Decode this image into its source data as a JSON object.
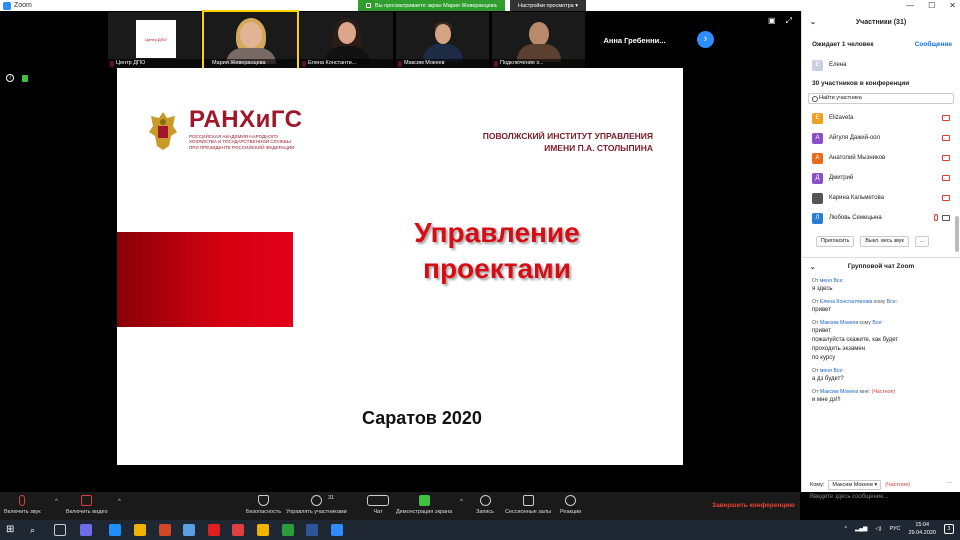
{
  "window": {
    "title": "Zoom",
    "controls": [
      "—",
      "☐",
      "✕"
    ]
  },
  "share_banner": {
    "text": "Вы просматриваете экран Мария Жеверанцева",
    "view_options": "Настройки просмотра ▾"
  },
  "video_tiles": [
    {
      "name": "Центр ДПО",
      "logo_text": "Центр ДПО"
    },
    {
      "name": "Мария Жеверанцева"
    },
    {
      "name": "Елена Константи..."
    },
    {
      "name": "Максим Мокеев"
    },
    {
      "name": "Подключение з..."
    },
    {
      "name": "Анна  Гребенни..."
    }
  ],
  "slide": {
    "brand": "РАНХиГС",
    "brand_sub": "Российская академия народного хозяйства и государственной службы при президенте российской федерации",
    "institute_line1": "ПОВОЛЖСКИЙ ИНСТИТУТ УПРАВЛЕНИЯ",
    "institute_line2": "ИМЕНИ П.А. СТОЛЫПИНА",
    "title_line1": "Управление",
    "title_line2": "проектами",
    "city": "Саратов 2020"
  },
  "participants_panel": {
    "title": "Участники (31)",
    "waiting_label": "Ожидает 1 человек",
    "message_link": "Сообщение",
    "waiting_user": {
      "initial": "Е",
      "name": "Елена",
      "color": "#c9d0e0"
    },
    "in_conference": "30 участников в конференции",
    "search_placeholder": "Найти участника",
    "participants": [
      {
        "initial": "E",
        "name": "Elizaveta",
        "color": "#f0a020"
      },
      {
        "initial": "А",
        "name": "Айгуля Дажий-оол",
        "color": "#8a4fc8"
      },
      {
        "initial": "А",
        "name": "Анатолий Мызников",
        "color": "#e86a1a"
      },
      {
        "initial": "Д",
        "name": "Дмитрий",
        "color": "#8a4fc8"
      },
      {
        "initial": "",
        "name": "Карина Кальметова",
        "color": "#555555"
      },
      {
        "initial": "Л",
        "name": "Любовь Семецына",
        "color": "#2a7ad8"
      }
    ],
    "invite_button": "Пригласить",
    "mute_all_button": "Выкл. весь звук",
    "more_button": "..."
  },
  "chat": {
    "title": "Групповой чат Zoom",
    "messages": [
      {
        "prefix": "От ",
        "from": "меня",
        "mid": " ",
        "to": "Все",
        "suffix": ":",
        "text": "я здесь"
      },
      {
        "prefix": "От ",
        "from": "Елена Константинова",
        "mid": " кому ",
        "to": "Все",
        "suffix": ":",
        "text": "привет"
      },
      {
        "prefix": "От ",
        "from": "Максим Мокеев",
        "mid": " кому ",
        "to": "Все",
        "suffix": ":",
        "text": "привет\nпожалуйста скажите, как будет\nпроходить экзамен\nпо курсу"
      },
      {
        "prefix": "От ",
        "from": "меня",
        "mid": " ",
        "to": "Все",
        "suffix": ":",
        "text": "а дз будет?"
      },
      {
        "prefix": "От ",
        "from": "Максим Мокеев",
        "mid": " мне: ",
        "to": "(Частное)",
        "suffix": "",
        "text": "и мне дз!!!"
      }
    ],
    "to_label": "Кому:",
    "to_value": "Максим Мокеев ▾",
    "to_private": "(Частное)",
    "more": "···",
    "input_placeholder": "Введите здесь сообщение..."
  },
  "toolbar": {
    "unmute": "Включить звук",
    "start_video": "Включить видео",
    "security": "Безопасность",
    "participants": "Управлять участниками",
    "participants_count": "31",
    "chat": "Чат",
    "share_screen": "Демонстрация экрана",
    "record": "Запись",
    "breakout": "Сессионные залы",
    "reactions": "Реакции",
    "end": "Завершить конференцию"
  },
  "taskbar": {
    "lang": "РУС",
    "time": "15:04",
    "date": "29.04.2020",
    "notifications": "3",
    "app_colors": [
      "#ffffff",
      "#cccccc",
      "#6e6ee8",
      "#1e90ff",
      "#f0b400",
      "#d24726",
      "#5aa0e0",
      "#e02020",
      "#e04040",
      "#f0b400",
      "#2a9d3a",
      "#2b579a",
      "#2D8CFF"
    ]
  },
  "colors": {
    "zoom_blue": "#2D8CFF",
    "end_red": "#e8412f",
    "brand_red": "#a1162a",
    "title_red": "#d60d14"
  }
}
